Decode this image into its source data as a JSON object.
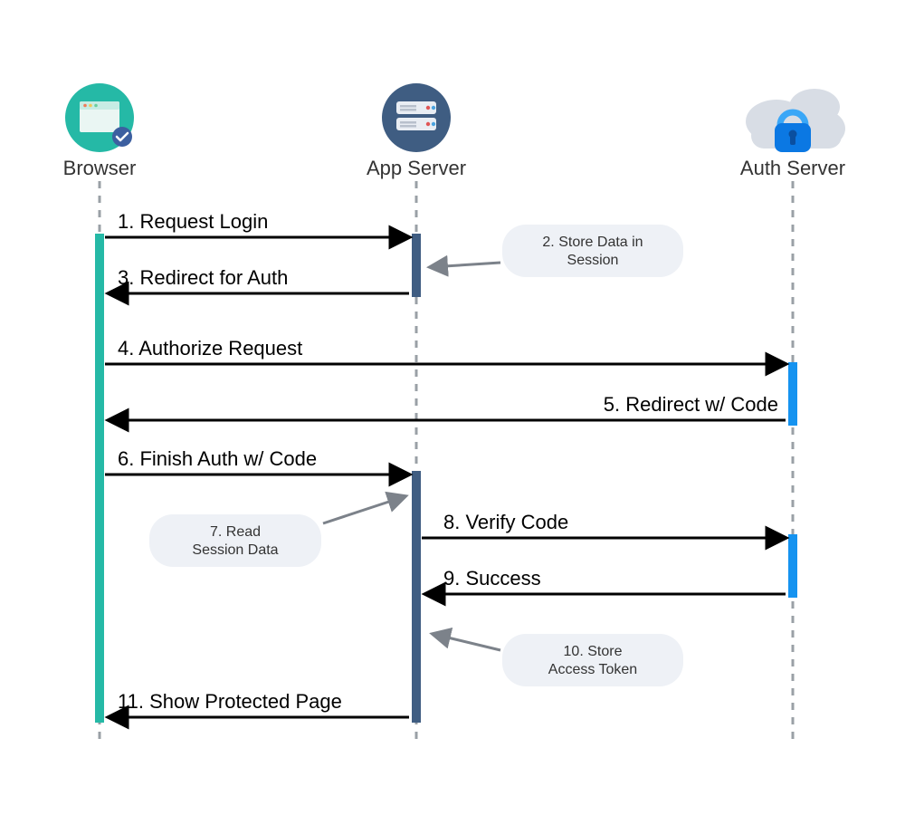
{
  "actors": {
    "browser": {
      "label": "Browser"
    },
    "app": {
      "label": "App Server"
    },
    "auth": {
      "label": "Auth Server"
    }
  },
  "messages": {
    "m1": "1. Request Login",
    "m3": "3. Redirect for Auth",
    "m4": "4. Authorize Request",
    "m5": "5. Redirect w/ Code",
    "m6": "6. Finish Auth w/ Code",
    "m8": "8. Verify Code",
    "m9": "9. Success",
    "m11": "11. Show Protected Page"
  },
  "notes": {
    "n2": {
      "line1": "2. Store Data in",
      "line2": "Session"
    },
    "n7": {
      "line1": "7. Read",
      "line2": "Session Data"
    },
    "n10": {
      "line1": "10. Store",
      "line2": "Access Token"
    }
  },
  "colors": {
    "browser_accent": "#25b9a6",
    "app_accent": "#3f5d82",
    "auth_accent": "#1593f0",
    "cloud": "#d8dde5",
    "lock_body": "#0b78e3"
  }
}
